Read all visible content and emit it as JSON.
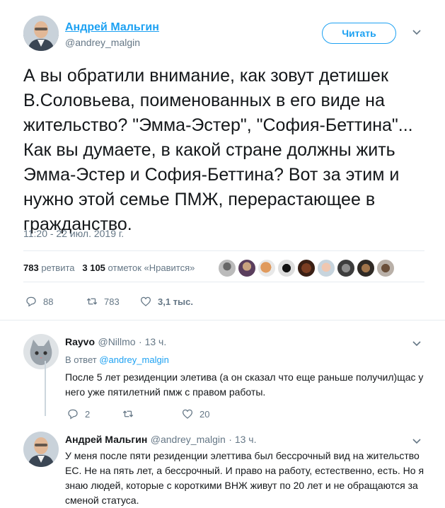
{
  "main_tweet": {
    "author_name": "Андрей Мальгин",
    "author_handle": "@andrey_malgin",
    "follow_label": "Читать",
    "text": "А вы обратили внимание, как зовут детишек В.Соловьева, поименованных в его виде на жительство? \"Эмма-Эстер\", \"София-Беттина\"... Как вы думаете, в какой стране должны жить Эмма-Эстер и София-Беттина? Вот за этим и нужно этой семье ПМЖ, перерастающее в гражданство.",
    "timestamp": "11:20 - 22 июл. 2019 г.",
    "retweets_count": "783",
    "retweets_label": "ретвита",
    "likes_count": "3 105",
    "likes_label": "отметок «Нравится»",
    "actions": {
      "replies": "88",
      "retweets": "783",
      "likes": "3,1 тыс."
    }
  },
  "replies": [
    {
      "name": "Rayvo",
      "handle": "@Nillmo",
      "time": "· 13 ч.",
      "in_reply_prefix": "В ответ",
      "in_reply_handle": "@andrey_malgin",
      "text": "После 5 лет резиденции элетива (а он сказал что еще раньше получил)щас у него уже пятилетний пмж с правом работы.",
      "actions": {
        "replies": "2",
        "retweets": "",
        "likes": "20"
      }
    },
    {
      "name": "Андрей Мальгин",
      "handle": "@andrey_malgin",
      "time": "· 13 ч.",
      "text": "У меня после пяти резиденции элеттива был бессрочный вид на жительство ЕС. Не на пять лет, а бессрочный. И право на работу, естественно, есть. Но я знаю людей, которые с короткими ВНЖ живут по 20 лет и не обращаются за сменой статуса."
    }
  ],
  "colors": {
    "accent": "#1da1f2",
    "muted": "#657786",
    "divider": "#e6ecf0"
  }
}
